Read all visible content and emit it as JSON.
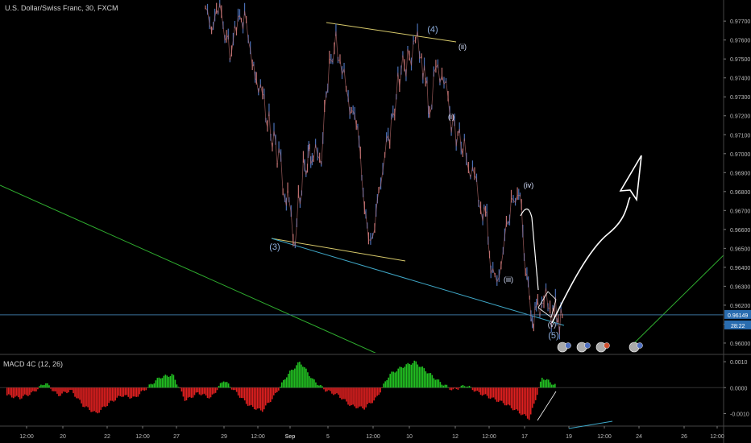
{
  "header": {
    "symbol_title": "U.S. Dollar/Swiss Franc, 30, FXCM"
  },
  "macd": {
    "title": "MACD 4C (12, 26)"
  },
  "colors": {
    "background": "#000000",
    "candle_line": "#4a6fb5",
    "candle_up": "#c07070",
    "wedge_line": "#d6c86a",
    "lower_trend": "#3fa8c8",
    "green_trend": "#2fae2f",
    "last_price_line": "#3a6f9a",
    "price_badge": "#2a6db0",
    "hist_up": "#22c022",
    "hist_down": "#e02020"
  },
  "chart_data": [
    {
      "type": "line",
      "title": "U.S. Dollar/Swiss Franc, 30, FXCM",
      "x_ticks": [
        "12:00",
        "20",
        "22",
        "12:00",
        "27",
        "29",
        "12:00",
        "Sep",
        "5",
        "12:00",
        "10",
        "12",
        "12:00",
        "17",
        "19",
        "12:00",
        "24",
        "26",
        "12:00"
      ],
      "y_ticks": [
        "0.97700",
        "0.97600",
        "0.97500",
        "0.97400",
        "0.97300",
        "0.97200",
        "0.97100",
        "0.97000",
        "0.96900",
        "0.96800",
        "0.96700",
        "0.96600",
        "0.96500",
        "0.96400",
        "0.96300",
        "0.96200",
        "0.96100",
        "0.96000"
      ],
      "ylim": [
        0.9597,
        0.9779
      ],
      "last_price": "0.96149",
      "countdown": "28:22",
      "series": [
        {
          "x": [
            0,
            0.3,
            0.7,
            1.2,
            1.6,
            2.0,
            2.3,
            2.5,
            2.8,
            3.2,
            3.6,
            3.9,
            4.1,
            4.4,
            4.8,
            5.0,
            5.1,
            5.3,
            5.6,
            6.0,
            6.4,
            6.7,
            7.0,
            7.4,
            7.6,
            7.8,
            8.0,
            8.3,
            8.5,
            8.8,
            9.2,
            9.6,
            10.0,
            10.3,
            10.6,
            10.8,
            11.0,
            11.3,
            11.6,
            11.9,
            12.3,
            12.7,
            13.0,
            13.3,
            13.6,
            13.8,
            14.0,
            14.3,
            14.6,
            15.0,
            15.3,
            15.5,
            15.7,
            15.9,
            16.1,
            16.3,
            16.6,
            16.9,
            17.1,
            17.3,
            17.5
          ],
          "values": [
            0.9774,
            0.9768,
            0.9776,
            0.9752,
            0.977,
            0.9772,
            0.9745,
            0.974,
            0.973,
            0.971,
            0.97,
            0.968,
            0.967,
            0.9658,
            0.969,
            0.97,
            0.9695,
            0.9705,
            0.969,
            0.974,
            0.976,
            0.9745,
            0.9728,
            0.9715,
            0.97,
            0.967,
            0.9655,
            0.966,
            0.968,
            0.97,
            0.972,
            0.9745,
            0.975,
            0.976,
            0.9752,
            0.9735,
            0.9725,
            0.974,
            0.9748,
            0.9722,
            0.9712,
            0.97,
            0.9695,
            0.968,
            0.967,
            0.9665,
            0.964,
            0.963,
            0.965,
            0.9675,
            0.968,
            0.967,
            0.964,
            0.962,
            0.9612,
            0.9618,
            0.9625,
            0.9615,
            0.9618,
            0.9612,
            0.9614
          ]
        }
      ],
      "annotations": {
        "wave_labels": [
          "(3)",
          "(4)",
          "(5)",
          "(i)",
          "(ii)",
          "(iii)",
          "(iv)",
          "(v)"
        ],
        "wave_prices": [
          0.9648,
          0.976,
          0.961,
          0.9713,
          0.975,
          0.9637,
          0.9681,
          0.9616
        ],
        "wave_x": [
          1.9,
          11.4,
          17.4,
          13.9,
          14.5,
          16.3,
          16.6,
          17.4
        ],
        "projected_path": {
          "x": [
            17.4,
            17.8,
            18.4,
            19.2,
            20.2
          ],
          "values": [
            0.9614,
            0.9625,
            0.965,
            0.9685,
            0.9695
          ]
        }
      },
      "grid": false
    },
    {
      "type": "bar",
      "title": "MACD 4C (12, 26)",
      "y_ticks": [
        "0.0010",
        "0.0000",
        "-0.0010"
      ],
      "ylim": [
        -0.00145,
        0.00125
      ],
      "values": [
        -0.0003,
        -0.0004,
        -0.0002,
        0.0002,
        -0.0003,
        -0.0001,
        -0.0007,
        -0.001,
        -0.0006,
        -0.0003,
        -0.0004,
        0.0,
        0.0004,
        0.0005,
        -0.0005,
        -0.0002,
        -0.0004,
        0.0003,
        -0.0002,
        -0.0007,
        -0.0009,
        -0.0003,
        0.0005,
        0.001,
        0.0003,
        -0.0001,
        -0.0003,
        -0.0007,
        -0.0008,
        -0.0004,
        0.0005,
        0.0008,
        0.001,
        0.0006,
        0.0002,
        -0.0001,
        0.0001,
        -0.0002,
        -0.0004,
        -0.0006,
        -0.0009,
        -0.0012,
        0.0004,
        0.0001
      ]
    }
  ]
}
